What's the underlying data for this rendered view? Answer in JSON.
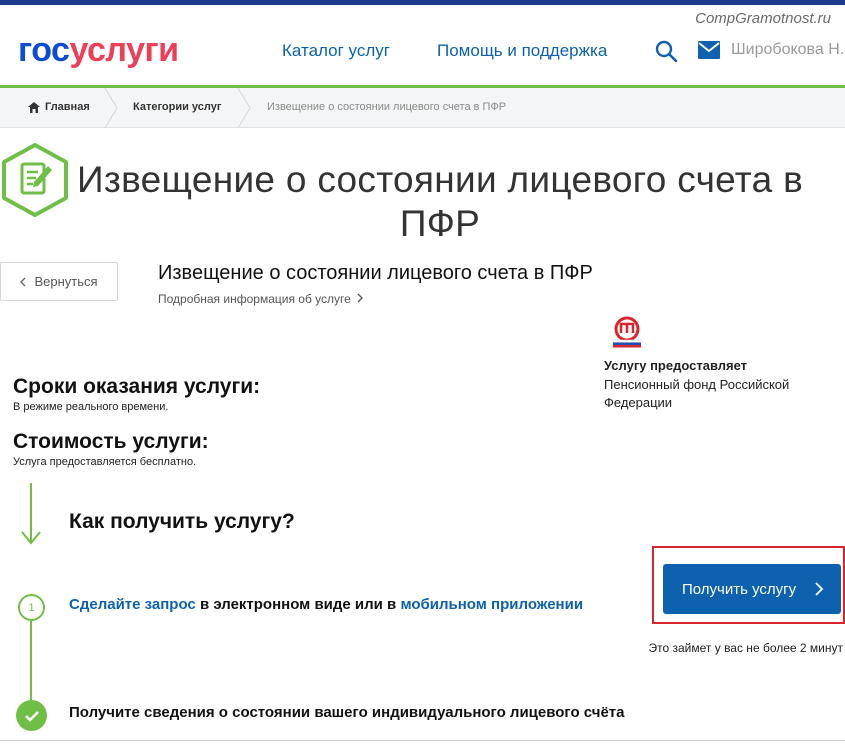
{
  "watermark": "CompGramotnost.ru",
  "header": {
    "logo_part1": "гос",
    "logo_part2": "услуги",
    "nav": {
      "catalog": "Каталог услуг",
      "help": "Помощь и поддержка"
    },
    "user_name": "Широбокова Н."
  },
  "breadcrumb": {
    "home": "Главная",
    "categories": "Категории услуг",
    "current": "Извещение о состоянии лицевого счета в ПФР"
  },
  "hero": {
    "title": "Извещение о состоянии лицевого счета в ПФР"
  },
  "service": {
    "back_label": "Вернуться",
    "title": "Извещение о состоянии лицевого счета в ПФР",
    "details_link": "Подробная информация об услуге"
  },
  "provider": {
    "label": "Услугу предоставляет",
    "name": "Пенсионный фонд Российской Федерации"
  },
  "terms": {
    "heading": "Сроки оказания услуги:",
    "value": "В режиме реального времени."
  },
  "cost": {
    "heading": "Стоимость услуги:",
    "value": "Услуга предоставляется бесплатно."
  },
  "how": {
    "title": "Как получить услугу?",
    "step1_number": "1",
    "step1_link1": "Сделайте запрос",
    "step1_mid": " в электронном виде или в ",
    "step1_link2": "мобильном приложении",
    "step2_text": "Получите сведения о состоянии вашего индивидуального лицевого счёта"
  },
  "cta": {
    "button_label": "Получить услугу",
    "note": "Это займет у вас не более 2 минут"
  },
  "colors": {
    "accent_blue": "#0d61af",
    "brand_blue": "#0d4cd3",
    "brand_red": "#ee3f58",
    "success_green": "#6fbf47",
    "highlight_red": "#d9262d"
  }
}
